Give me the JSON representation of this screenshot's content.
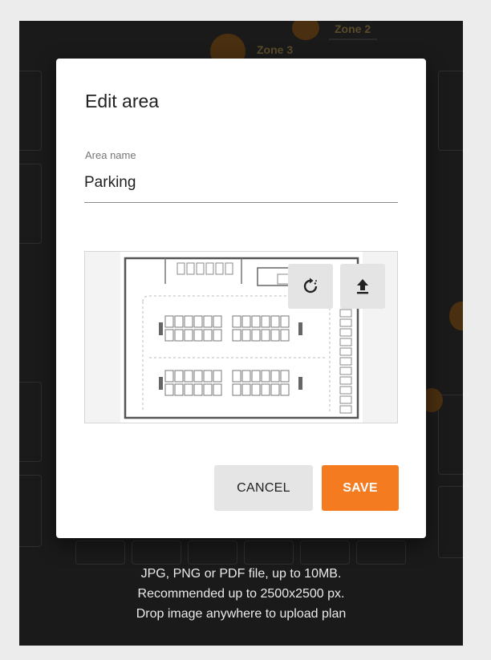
{
  "background": {
    "zone_labels": [
      "Zone 2",
      "Zone 3"
    ]
  },
  "dialog": {
    "title": "Edit area",
    "field": {
      "label": "Area name",
      "value": "Parking"
    },
    "plan_preview": {
      "rotate_icon": "rotate-icon",
      "upload_icon": "upload-icon"
    },
    "actions": {
      "cancel_label": "CANCEL",
      "save_label": "SAVE"
    }
  },
  "upload_info": {
    "line1": "JPG, PNG or PDF file, up to 10MB.",
    "line2": "Recommended up to 2500x2500 px.",
    "line3": "Drop image anywhere to upload plan"
  },
  "colors": {
    "accent": "#f47b20",
    "overlay": "#1a1a1a",
    "dialog_bg": "#ffffff"
  }
}
